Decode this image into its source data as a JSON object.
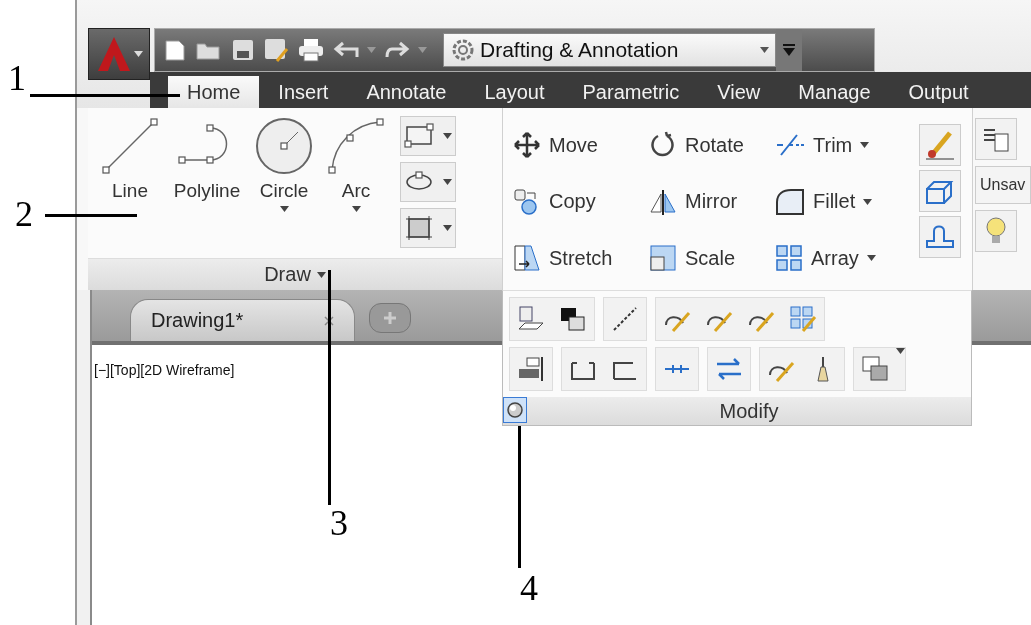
{
  "quick_access": {
    "workspace": "Drafting & Annotation"
  },
  "tabs": [
    {
      "label": "Home",
      "selected": true
    },
    {
      "label": "Insert",
      "selected": false
    },
    {
      "label": "Annotate",
      "selected": false
    },
    {
      "label": "Layout",
      "selected": false
    },
    {
      "label": "Parametric",
      "selected": false
    },
    {
      "label": "View",
      "selected": false
    },
    {
      "label": "Manage",
      "selected": false
    },
    {
      "label": "Output",
      "selected": false
    }
  ],
  "draw_panel": {
    "title": "Draw",
    "tools": [
      {
        "label": "Line",
        "has_menu": false
      },
      {
        "label": "Polyline",
        "has_menu": false
      },
      {
        "label": "Circle",
        "has_menu": true
      },
      {
        "label": "Arc",
        "has_menu": true
      }
    ]
  },
  "modify_panel": {
    "title": "Modify",
    "expanded": true,
    "tools": [
      {
        "label": "Move",
        "has_menu": false
      },
      {
        "label": "Rotate",
        "has_menu": false
      },
      {
        "label": "Trim",
        "has_menu": true
      },
      {
        "label": "Copy",
        "has_menu": false
      },
      {
        "label": "Mirror",
        "has_menu": false
      },
      {
        "label": "Fillet",
        "has_menu": true
      },
      {
        "label": "Stretch",
        "has_menu": false
      },
      {
        "label": "Scale",
        "has_menu": false
      },
      {
        "label": "Array",
        "has_menu": true
      }
    ]
  },
  "layers_panel": {
    "layer_field": "Unsav"
  },
  "document_tabs": [
    {
      "label": "Drawing1*",
      "selected": true
    }
  ],
  "viewport_label": "[−][Top][2D Wireframe]",
  "callouts": [
    {
      "label": "1"
    },
    {
      "label": "2"
    },
    {
      "label": "3"
    },
    {
      "label": "4"
    }
  ]
}
